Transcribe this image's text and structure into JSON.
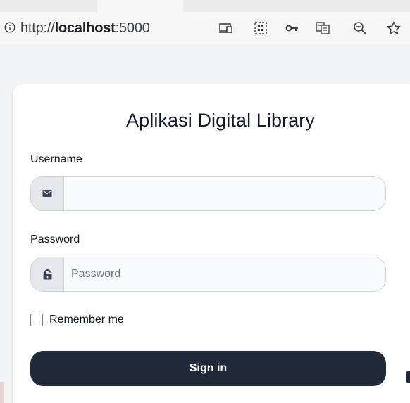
{
  "browser": {
    "url_scheme": "http://",
    "url_host": "localhost",
    "url_port": ":5000",
    "toolbar_icons": [
      "cast-icon",
      "qr-code-icon",
      "key-icon",
      "translate-icon",
      "zoom-out-icon",
      "bookmark-star-icon"
    ]
  },
  "login": {
    "title": "Aplikasi Digital Library",
    "username_label": "Username",
    "username_value": "",
    "username_placeholder": "",
    "password_label": "Password",
    "password_placeholder": "Password",
    "remember_label": "Remember me",
    "signin_label": "Sign in"
  },
  "colors": {
    "button_bg": "#1f2937",
    "page_bg": "#f3f4f6",
    "addon_bg": "#e5e7eb"
  }
}
